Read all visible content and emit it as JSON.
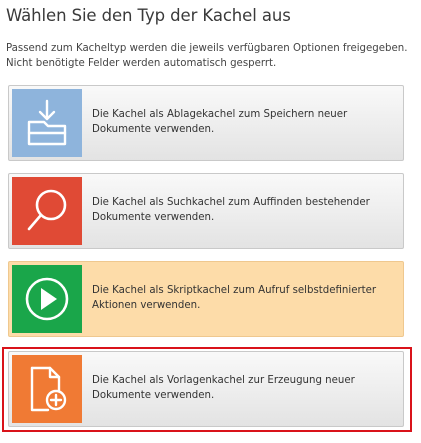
{
  "dialog": {
    "title": "Wählen Sie den Typ der Kachel aus",
    "intro": "Passend zum Kacheltyp werden die jeweils verfügbaren Optionen freigegeben. Nicht benötigte Felder werden automatisch gesperrt."
  },
  "tiles": [
    {
      "name": "tile-option-ablage",
      "icon": "folder-download-icon",
      "color": "#8eb4dc",
      "description": "Die Kachel als Ablagekachel zum Speichern neuer Dokumente verwenden."
    },
    {
      "name": "tile-option-suche",
      "icon": "search-icon",
      "color": "#e04a35",
      "description": "Die Kachel als Suchkachel zum Auffinden bestehender Dokumente verwenden."
    },
    {
      "name": "tile-option-skript",
      "icon": "play-icon",
      "color": "#1aa64a",
      "description": "Die Kachel als Skriptkachel zum Aufruf selbstdefinierter Aktionen verwenden.",
      "highlighted": true
    },
    {
      "name": "tile-option-vorlage",
      "icon": "document-add-icon",
      "color": "#f07a34",
      "description": "Die Kachel als Vorlagenkachel zur Erzeugung neuer Dokumente verwenden.",
      "selected": true
    }
  ],
  "colors": {
    "selection_border": "#d9131a",
    "highlight_background": "#fddca9"
  }
}
